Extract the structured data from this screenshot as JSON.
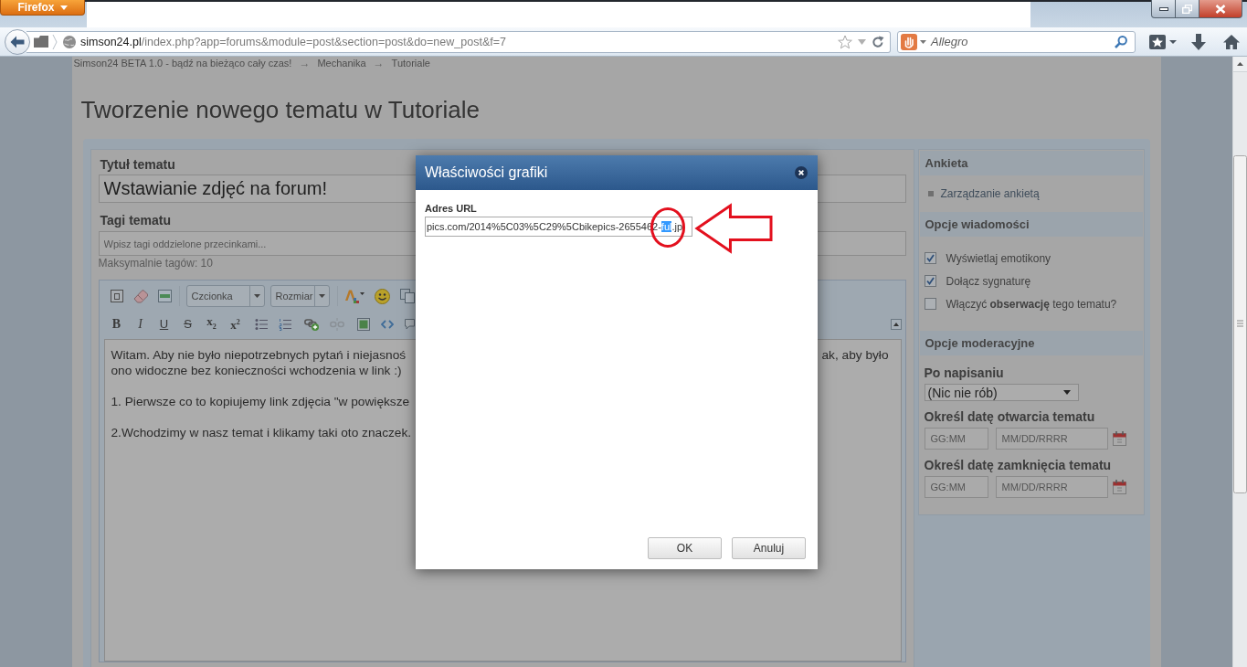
{
  "browser": {
    "menu_button": "Firefox",
    "url_domain": "simson24.pl",
    "url_path": "/index.php?app=forums&module=post&section=post&do=new_post&f=7",
    "search_placeholder": "Allegro"
  },
  "breadcrumb": [
    {
      "kind": "link",
      "text": "Simson24 BETA 1.0 - bądź na bieżąco cały czas!"
    },
    {
      "kind": "separator",
      "text": "→"
    },
    {
      "kind": "link",
      "text": "Mechanika"
    },
    {
      "kind": "separator",
      "text": "→"
    },
    {
      "kind": "link",
      "text": "Tutoriale"
    }
  ],
  "page_title": "Tworzenie nowego tematu w Tutoriale",
  "topic_form": {
    "title_label": "Tytuł tematu",
    "title_value": "Wstawianie zdjęć na forum!",
    "tags_label": "Tagi tematu",
    "tags_placeholder": "Wpisz tagi oddzielone przecinkami...",
    "tags_hint": "Maksymalnie tagów: 10"
  },
  "editor": {
    "toolbar": [
      [
        [
          {
            "kind": "document",
            "disabled": false
          },
          {
            "kind": "eraser",
            "disabled": false
          },
          {
            "kind": "rule",
            "disabled": false
          }
        ],
        [
          {
            "kind": "select",
            "label": "Czcionka",
            "disabled": false
          },
          {
            "kind": "select",
            "label": "Rozmiar",
            "disabled": false
          }
        ],
        [
          {
            "kind": "font-color",
            "disabled": false
          },
          {
            "kind": "emoticon",
            "disabled": false
          },
          {
            "kind": "copy",
            "disabled": false
          }
        ]
      ],
      [
        [
          {
            "kind": "bold",
            "label": "B",
            "disabled": false
          },
          {
            "kind": "italic",
            "label": "I",
            "disabled": false
          },
          {
            "kind": "underline",
            "label": "U",
            "disabled": false
          },
          {
            "kind": "strike",
            "label": "S",
            "disabled": false
          },
          {
            "kind": "subscript",
            "label": "x$_{2}$",
            "disabled": false
          },
          {
            "kind": "superscript",
            "label": "x$^{2}$",
            "disabled": false
          }
        ],
        [
          {
            "kind": "bullets",
            "disabled": false
          },
          {
            "kind": "numbering",
            "disabled": false
          }
        ],
        [
          {
            "kind": "link",
            "disabled": false
          },
          {
            "kind": "unlink",
            "disabled": true
          }
        ],
        [
          {
            "kind": "image",
            "disabled": false
          },
          {
            "kind": "code",
            "disabled": false
          },
          {
            "kind": "quote",
            "disabled": false
          }
        ]
      ]
    ],
    "paragraphs": [
      {
        "lines": [
          {
            "text": "Witam. Aby nie było niepotrzebnych pytań i niejasnoś",
            "tail": "ak, aby było"
          },
          {
            "text": "ono widoczne bez konieczności wchodzenia w link :)"
          }
        ]
      },
      {
        "lines": [
          {
            "text": "1. Pierwsze co to kopiujemy link zdjęcia \"w powiększe"
          }
        ]
      },
      {
        "lines": [
          {
            "text": "2.Wchodzimy w nasz temat i klikamy taki oto znaczek."
          }
        ]
      }
    ]
  },
  "sidebar": {
    "sections": [
      {
        "title": "Ankieta",
        "items": [
          {
            "kind": "link",
            "label": "Zarządzanie ankietą"
          }
        ]
      },
      {
        "title": "Opcje wiadomości",
        "items": [
          {
            "kind": "checkbox",
            "label": "Wyświetlaj emotikony",
            "checked": true
          },
          {
            "kind": "checkbox",
            "label": "Dołącz sygnaturę",
            "checked": true
          },
          {
            "kind": "checkbox",
            "label": "Włączyć **obserwację** tego tematu?",
            "checked": false
          }
        ]
      },
      {
        "title": "Opcje moderacyjne",
        "items": [
          {
            "kind": "select",
            "label": "Po napisaniu",
            "value": "(Nic nie rób)"
          },
          {
            "kind": "date",
            "label": "Określ datę otwarcia tematu",
            "time_placeholder": "GG:MM",
            "date_placeholder": "MM/DD/RRRR"
          },
          {
            "kind": "date",
            "label": "Określ datę zamknięcia tematu",
            "time_placeholder": "GG:MM",
            "date_placeholder": "MM/DD/RRRR"
          }
        ]
      }
    ]
  },
  "dialog": {
    "title": "Właściwości grafiki",
    "field_label": "Adres URL",
    "url_value": [
      {
        "text": "pics.com/2014%5C03%5C29%5Cbikepics-2655462-",
        "selected": false
      },
      {
        "text": "ful",
        "selected": true
      },
      {
        "text": ".jp",
        "selected": false
      }
    ],
    "buttons": [
      {
        "label": "OK"
      },
      {
        "label": "Anuluj"
      }
    ]
  },
  "annotations": [
    {
      "kind": "circle"
    },
    {
      "kind": "arrow"
    }
  ]
}
